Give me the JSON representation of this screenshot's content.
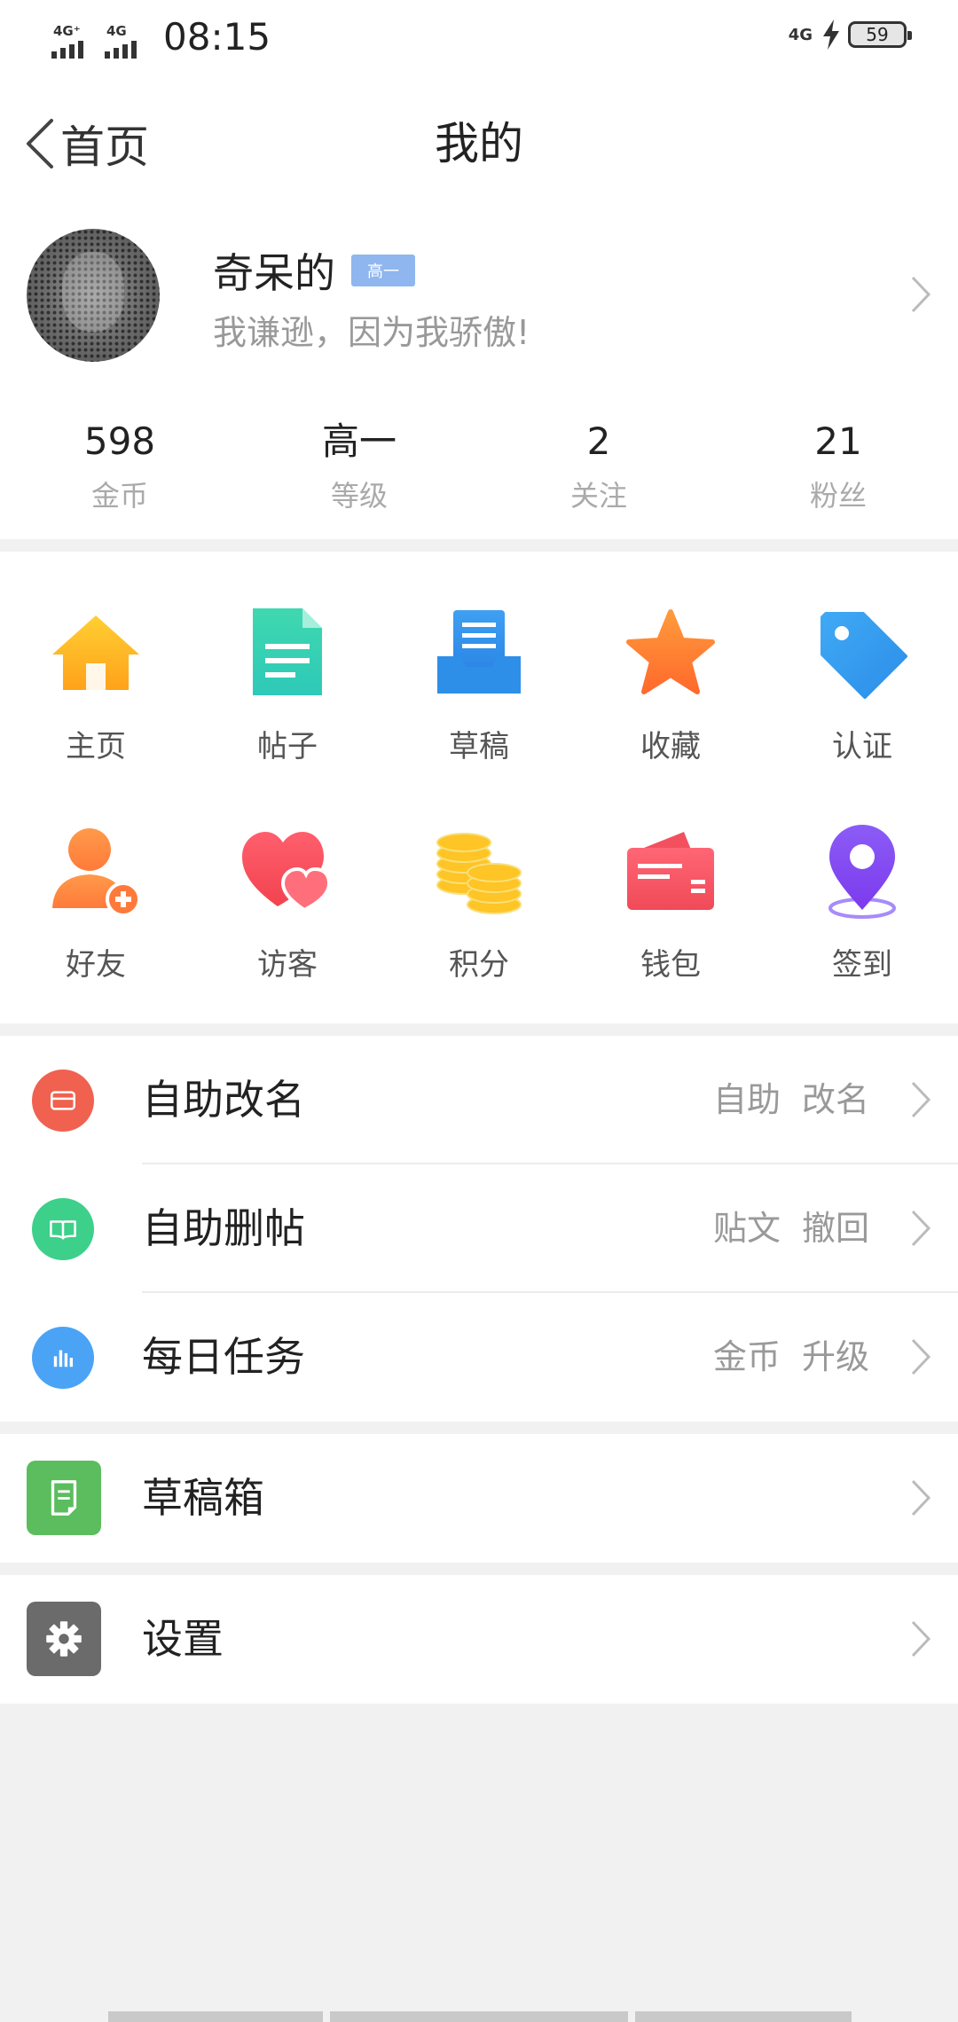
{
  "status_bar": {
    "signal1": "4G⁺",
    "signal2": "4G",
    "time": "08:15",
    "network_right": "4G",
    "battery": "59"
  },
  "nav": {
    "back_label": "首页",
    "title": "我的"
  },
  "profile": {
    "name": "奇呆的",
    "level_badge": "高一",
    "motto": "我谦逊，因为我骄傲!"
  },
  "stats": [
    {
      "value": "598",
      "label": "金币"
    },
    {
      "value": "高一",
      "label": "等级"
    },
    {
      "value": "2",
      "label": "关注"
    },
    {
      "value": "21",
      "label": "粉丝"
    }
  ],
  "grid": [
    {
      "label": "主页",
      "icon": "home-icon"
    },
    {
      "label": "帖子",
      "icon": "document-icon"
    },
    {
      "label": "草稿",
      "icon": "draft-tray-icon"
    },
    {
      "label": "收藏",
      "icon": "star-icon"
    },
    {
      "label": "认证",
      "icon": "tag-icon"
    },
    {
      "label": "好友",
      "icon": "add-friend-icon"
    },
    {
      "label": "访客",
      "icon": "hearts-icon"
    },
    {
      "label": "积分",
      "icon": "coins-icon"
    },
    {
      "label": "钱包",
      "icon": "wallet-icon"
    },
    {
      "label": "签到",
      "icon": "location-pin-icon"
    }
  ],
  "list1": [
    {
      "title": "自助改名",
      "tags": [
        "自助",
        "改名"
      ],
      "icon": "wallet-card-icon",
      "color": "#f0614f"
    },
    {
      "title": "自助删帖",
      "tags": [
        "贴文",
        "撤回"
      ],
      "icon": "book-icon",
      "color": "#3dd08a"
    },
    {
      "title": "每日任务",
      "tags": [
        "金币",
        "升级"
      ],
      "icon": "bar-chart-icon",
      "color": "#4aa3f5"
    }
  ],
  "list2": {
    "title": "草稿箱",
    "icon": "draft-box-icon",
    "color": "#5bbd5e"
  },
  "list3": {
    "title": "设置",
    "icon": "gear-icon",
    "color": "#6b6b6b"
  }
}
